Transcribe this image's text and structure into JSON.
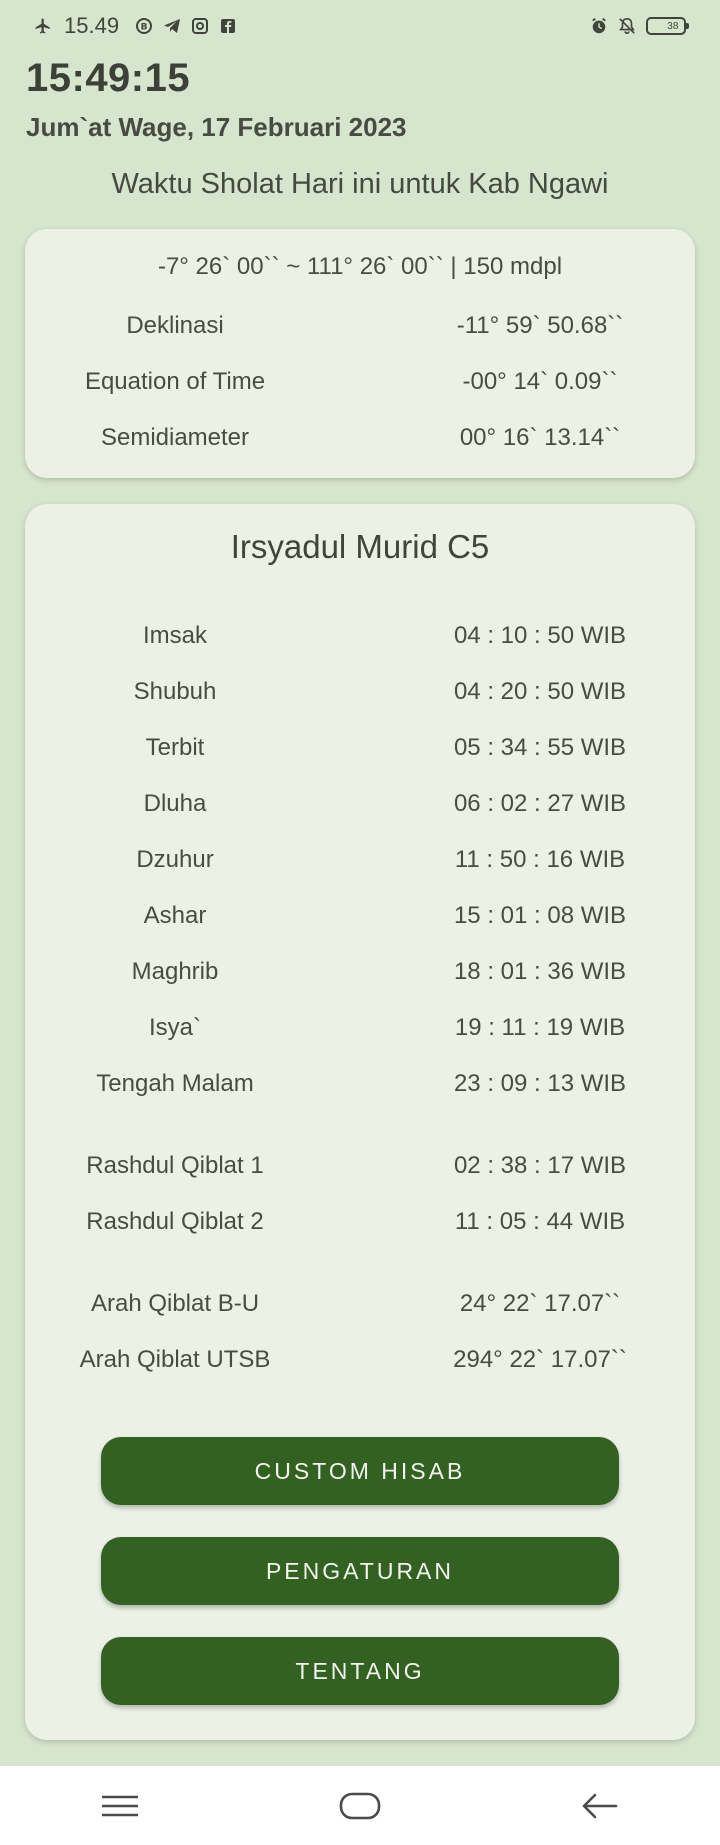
{
  "status_bar": {
    "time": "15.49",
    "battery": "38",
    "left_icons": [
      "airplane-icon",
      "whatsapp-business-icon",
      "telegram-icon",
      "instagram-icon",
      "facebook-icon"
    ],
    "right_icons": [
      "alarm-icon",
      "notifications-off-icon",
      "battery-icon"
    ]
  },
  "clock": "15:49:15",
  "date": "Jum`at Wage, 17 Februari 2023",
  "subtitle": "Waktu Sholat Hari ini untuk Kab  Ngawi",
  "astro": {
    "coords": "-7° 26` 00`` ~ 111° 26` 00`` | 150 mdpl",
    "rows": [
      {
        "label": "Deklinasi",
        "value": "-11° 59` 50.68``"
      },
      {
        "label": "Equation of Time",
        "value": "-00° 14` 0.09``"
      },
      {
        "label": "Semidiameter",
        "value": "00° 16` 13.14``"
      }
    ]
  },
  "method_title": "Irsyadul Murid C5",
  "prayer_times": [
    {
      "label": "Imsak",
      "value": "04 : 10 : 50  WIB"
    },
    {
      "label": "Shubuh",
      "value": "04 : 20 : 50  WIB"
    },
    {
      "label": "Terbit",
      "value": "05 : 34 : 55  WIB"
    },
    {
      "label": "Dluha",
      "value": "06 : 02 : 27  WIB"
    },
    {
      "label": "Dzuhur",
      "value": "11 : 50 : 16  WIB"
    },
    {
      "label": "Ashar",
      "value": "15 : 01 : 08  WIB"
    },
    {
      "label": "Maghrib",
      "value": "18 : 01 : 36  WIB"
    },
    {
      "label": "Isya`",
      "value": "19 : 11 : 19  WIB"
    },
    {
      "label": "Tengah Malam",
      "value": "23 : 09 : 13  WIB"
    }
  ],
  "qibla_times": [
    {
      "label": "Rashdul Qiblat 1",
      "value": "02 : 38 : 17  WIB"
    },
    {
      "label": "Rashdul Qiblat 2",
      "value": "11 : 05 : 44  WIB"
    }
  ],
  "qibla_direction": [
    {
      "label": "Arah Qiblat B-U",
      "value": "24° 22` 17.07``"
    },
    {
      "label": "Arah Qiblat UTSB",
      "value": "294° 22` 17.07``"
    }
  ],
  "buttons": {
    "custom_hisab": "CUSTOM HISAB",
    "settings": "PENGATURAN",
    "about": "TENTANG"
  },
  "nav": [
    "menu-icon",
    "home-icon",
    "back-icon"
  ],
  "colors": {
    "background": "#d6e5cd",
    "card": "#ecf1e6",
    "button": "#336121",
    "button_text": "#f2f6ee"
  }
}
